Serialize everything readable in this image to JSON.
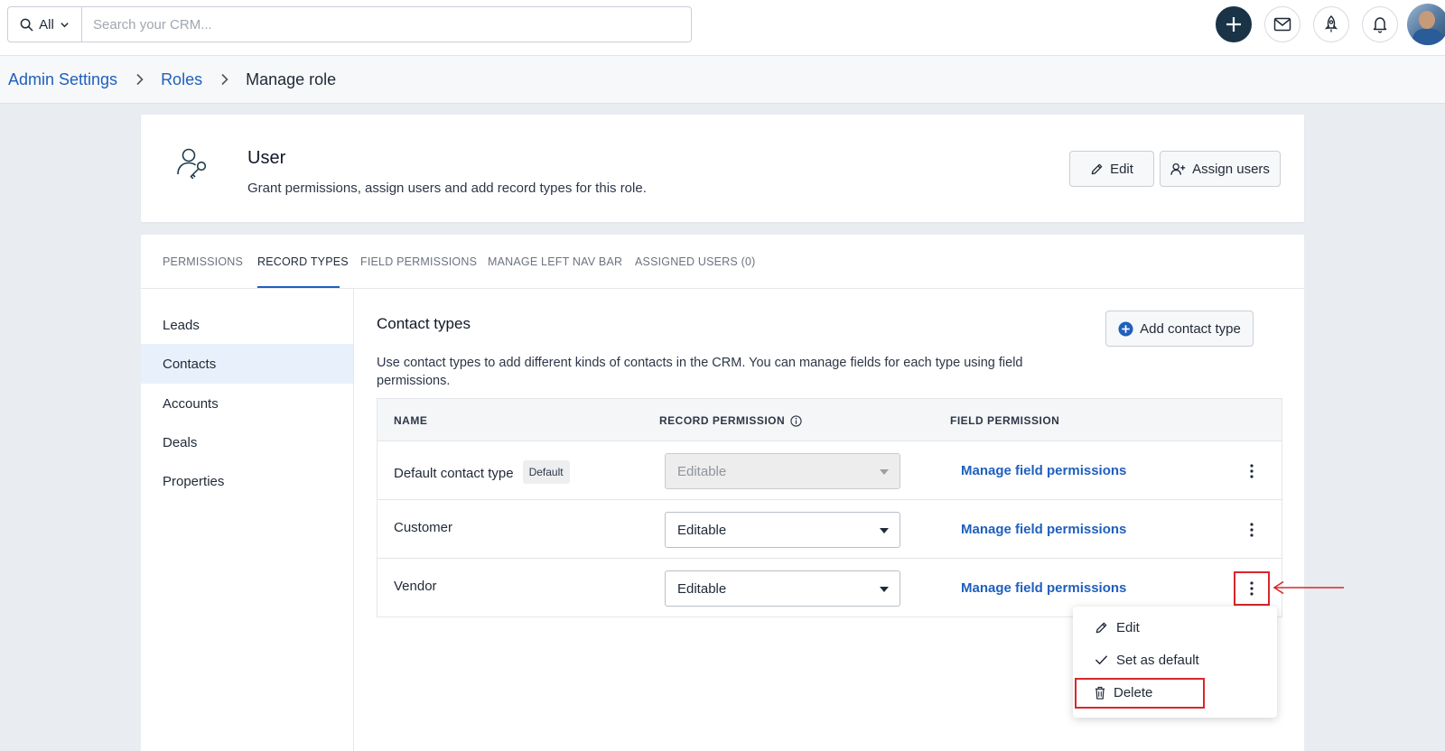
{
  "search": {
    "scope_label": "All",
    "placeholder": "Search your CRM..."
  },
  "top_icons": [
    "plus-icon",
    "mail-icon",
    "rocket-icon",
    "bell-icon",
    "user-avatar"
  ],
  "breadcrumb": {
    "items": [
      "Admin Settings",
      "Roles"
    ],
    "current": "Manage role"
  },
  "role": {
    "title": "User",
    "subtitle": "Grant permissions, assign users and add record types for this role.",
    "edit_label": "Edit",
    "assign_label": "Assign users"
  },
  "tabs": [
    {
      "label": "PERMISSIONS",
      "active": false
    },
    {
      "label": "RECORD TYPES",
      "active": true
    },
    {
      "label": "FIELD PERMISSIONS",
      "active": false
    },
    {
      "label": "MANAGE LEFT NAV BAR",
      "active": false
    },
    {
      "label": "ASSIGNED USERS (0)",
      "active": false
    }
  ],
  "nav": [
    {
      "label": "Leads",
      "active": false
    },
    {
      "label": "Contacts",
      "active": true
    },
    {
      "label": "Accounts",
      "active": false
    },
    {
      "label": "Deals",
      "active": false
    },
    {
      "label": "Properties",
      "active": false
    }
  ],
  "content": {
    "title": "Contact types",
    "description": "Use contact types to add different kinds of contacts in the CRM. You can manage fields for each type using field permissions.",
    "add_label": "Add contact type"
  },
  "table": {
    "headers": [
      "NAME",
      "RECORD PERMISSION",
      "FIELD PERMISSION"
    ],
    "rows": [
      {
        "name": "Default contact type",
        "badge": "Default",
        "permission": "Editable",
        "disabled": true,
        "link": "Manage field permissions"
      },
      {
        "name": "Customer",
        "badge": "",
        "permission": "Editable",
        "disabled": false,
        "link": "Manage field permissions"
      },
      {
        "name": "Vendor",
        "badge": "",
        "permission": "Editable",
        "disabled": false,
        "link": "Manage field permissions"
      }
    ]
  },
  "menu": {
    "items": [
      "Edit",
      "Set as default",
      "Delete"
    ]
  },
  "colors": {
    "accent": "#1f5fbf",
    "annotation": "#d9262c",
    "primary_button": "#1a3347"
  }
}
